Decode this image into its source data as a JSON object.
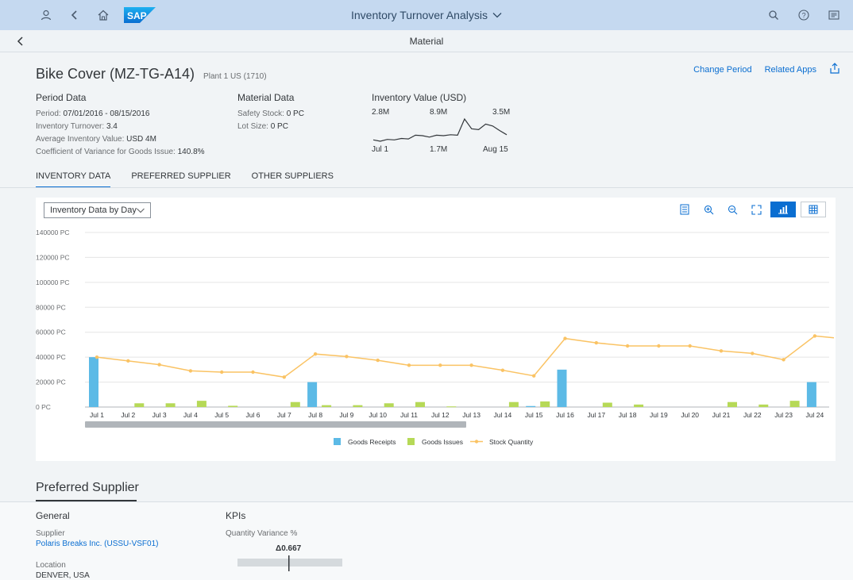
{
  "shell": {
    "title": "Inventory Turnover Analysis",
    "logo": "SAP",
    "icons_left": [
      "user-icon",
      "back-icon",
      "home-icon"
    ],
    "icons_right": [
      "search-icon",
      "help-icon",
      "notifications-icon"
    ]
  },
  "subheader": {
    "title": "Material"
  },
  "object": {
    "title": "Bike Cover (MZ-TG-A14)",
    "subtitle": "Plant 1 US (1710)",
    "actions": {
      "change_period": "Change Period",
      "related_apps": "Related Apps"
    },
    "period_data": {
      "heading": "Period Data",
      "period_label": "Period:",
      "period_value": "07/01/2016 - 08/15/2016",
      "turnover_label": "Inventory Turnover:",
      "turnover_value": "3.4",
      "avg_label": "Average Inventory Value:",
      "avg_value": "USD 4M",
      "cov_label": "Coefficient of Variance for Goods Issue:",
      "cov_value": "140.8%"
    },
    "material_data": {
      "heading": "Material Data",
      "safety_label": "Safety Stock:",
      "safety_value": "0 PC",
      "lot_label": "Lot Size:",
      "lot_value": "0 PC"
    },
    "inventory_value": {
      "heading": "Inventory Value (USD)",
      "top_left": "2.8M",
      "top_mid": "8.9M",
      "top_right": "3.5M",
      "bottom_left": "Jul 1",
      "bottom_mid": "1.7M",
      "bottom_right": "Aug 15",
      "sparkline": [
        2.4,
        2.1,
        2.5,
        2.4,
        2.7,
        2.6,
        3.4,
        3.3,
        3.0,
        3.4,
        3.3,
        3.5,
        3.4,
        6.9,
        4.8,
        4.6,
        5.8,
        5.4,
        4.4,
        3.5
      ]
    }
  },
  "tabs": [
    "INVENTORY DATA",
    "PREFERRED SUPPLIER",
    "OTHER SUPPLIERS"
  ],
  "chart_card": {
    "dropdown": "Inventory Data by Day",
    "toolbar": [
      "details-icon",
      "zoom-in-icon",
      "zoom-out-icon",
      "fullscreen-icon",
      "chart-view-icon",
      "table-view-icon"
    ]
  },
  "chart_data": {
    "type": "bar",
    "categories": [
      "Jul 1",
      "Jul 2",
      "Jul 3",
      "Jul 4",
      "Jul 5",
      "Jul 6",
      "Jul 7",
      "Jul 8",
      "Jul 9",
      "Jul 10",
      "Jul 11",
      "Jul 12",
      "Jul 13",
      "Jul 14",
      "Jul 15",
      "Jul 16",
      "Jul 17",
      "Jul 18",
      "Jul 19",
      "Jul 20",
      "Jul 21",
      "Jul 22",
      "Jul 23",
      "Jul 24"
    ],
    "y_ticks": [
      "140000 PC",
      "120000 PC",
      "100000 PC",
      "80000 PC",
      "60000 PC",
      "40000 PC",
      "20000 PC",
      "0 PC"
    ],
    "ylim": [
      0,
      140000
    ],
    "series": [
      {
        "name": "Goods Receipts",
        "type": "bar",
        "color": "#5cbae6",
        "values": [
          40000,
          0,
          0,
          0,
          0,
          0,
          0,
          20000,
          0,
          0,
          0,
          0,
          0,
          0,
          800,
          30000,
          0,
          0,
          0,
          0,
          0,
          0,
          0,
          20000
        ]
      },
      {
        "name": "Goods Issues",
        "type": "bar",
        "color": "#b6d957",
        "values": [
          0,
          3000,
          3000,
          5000,
          1000,
          0,
          4000,
          1500,
          1500,
          3000,
          4000,
          500,
          0,
          4000,
          4500,
          0,
          3500,
          2000,
          0,
          0,
          4000,
          2000,
          5000,
          0
        ]
      },
      {
        "name": "Stock Quantity",
        "type": "line",
        "color": "#fac364",
        "values": [
          40000,
          37000,
          34000,
          29000,
          28000,
          28000,
          24000,
          42500,
          40500,
          37500,
          33500,
          33500,
          33500,
          29500,
          25000,
          55000,
          51500,
          49000,
          49000,
          49000,
          45000,
          43000,
          38000,
          57000
        ]
      }
    ],
    "legend_position": "bottom",
    "grid": true
  },
  "preferred_supplier": {
    "title": "Preferred Supplier",
    "general": {
      "heading": "General",
      "supplier_label": "Supplier",
      "supplier_value": "Polaris Breaks Inc. (USSU-VSF01)",
      "location_label": "Location",
      "location_value": "DENVER, USA"
    },
    "kpis": {
      "heading": "KPIs",
      "qv_label": "Quantity Variance %",
      "qv_value": "Δ0.667"
    }
  }
}
